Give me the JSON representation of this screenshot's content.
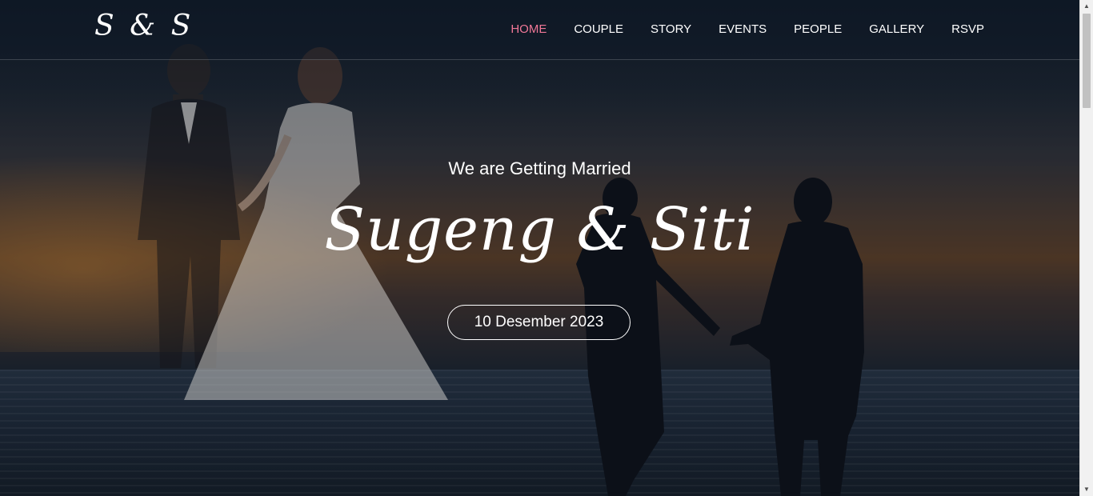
{
  "brand": {
    "logo": "S & S"
  },
  "nav": {
    "items": [
      {
        "label": "HOME",
        "active": true
      },
      {
        "label": "COUPLE",
        "active": false
      },
      {
        "label": "STORY",
        "active": false
      },
      {
        "label": "EVENTS",
        "active": false
      },
      {
        "label": "PEOPLE",
        "active": false
      },
      {
        "label": "GALLERY",
        "active": false
      },
      {
        "label": "RSVP",
        "active": false
      }
    ],
    "active_color": "#f07797"
  },
  "hero": {
    "subtitle": "We are Getting Married",
    "names": "Sugeng & Siti",
    "date": "10 Desember 2023"
  },
  "scrollbar": {
    "up_icon": "arrow-up-icon",
    "down_icon": "arrow-down-icon"
  }
}
